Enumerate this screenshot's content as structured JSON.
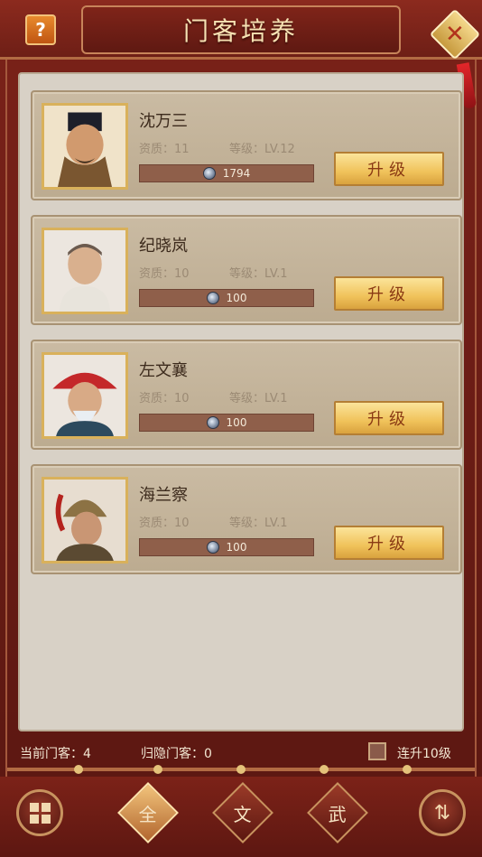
{
  "header": {
    "title": "门客培养",
    "help_label": "?",
    "close_label": "✕"
  },
  "cards": [
    {
      "name": "沈万三",
      "quality_label": "资质",
      "quality_value": "11",
      "level_label": "等级",
      "level_value": "LV.12",
      "cost": "1794",
      "button_label": "升级"
    },
    {
      "name": "纪晓岚",
      "quality_label": "资质",
      "quality_value": "10",
      "level_label": "等级",
      "level_value": "LV.1",
      "cost": "100",
      "button_label": "升级"
    },
    {
      "name": "左文襄",
      "quality_label": "资质",
      "quality_value": "10",
      "level_label": "等级",
      "level_value": "LV.1",
      "cost": "100",
      "button_label": "升级"
    },
    {
      "name": "海兰察",
      "quality_label": "资质",
      "quality_value": "10",
      "level_label": "等级",
      "level_value": "LV.1",
      "cost": "100",
      "button_label": "升级"
    }
  ],
  "footer": {
    "current_label": "当前门客：4",
    "retired_label": "归隐门客：0",
    "continuous_label": "连升10级"
  },
  "bottom_nav": {
    "tabs": [
      "全",
      "文",
      "武"
    ],
    "active_tab": "全"
  },
  "colors": {
    "accent": "#7b2219",
    "button_gold": "#f0c25a",
    "panel": "#d8d1c6"
  }
}
